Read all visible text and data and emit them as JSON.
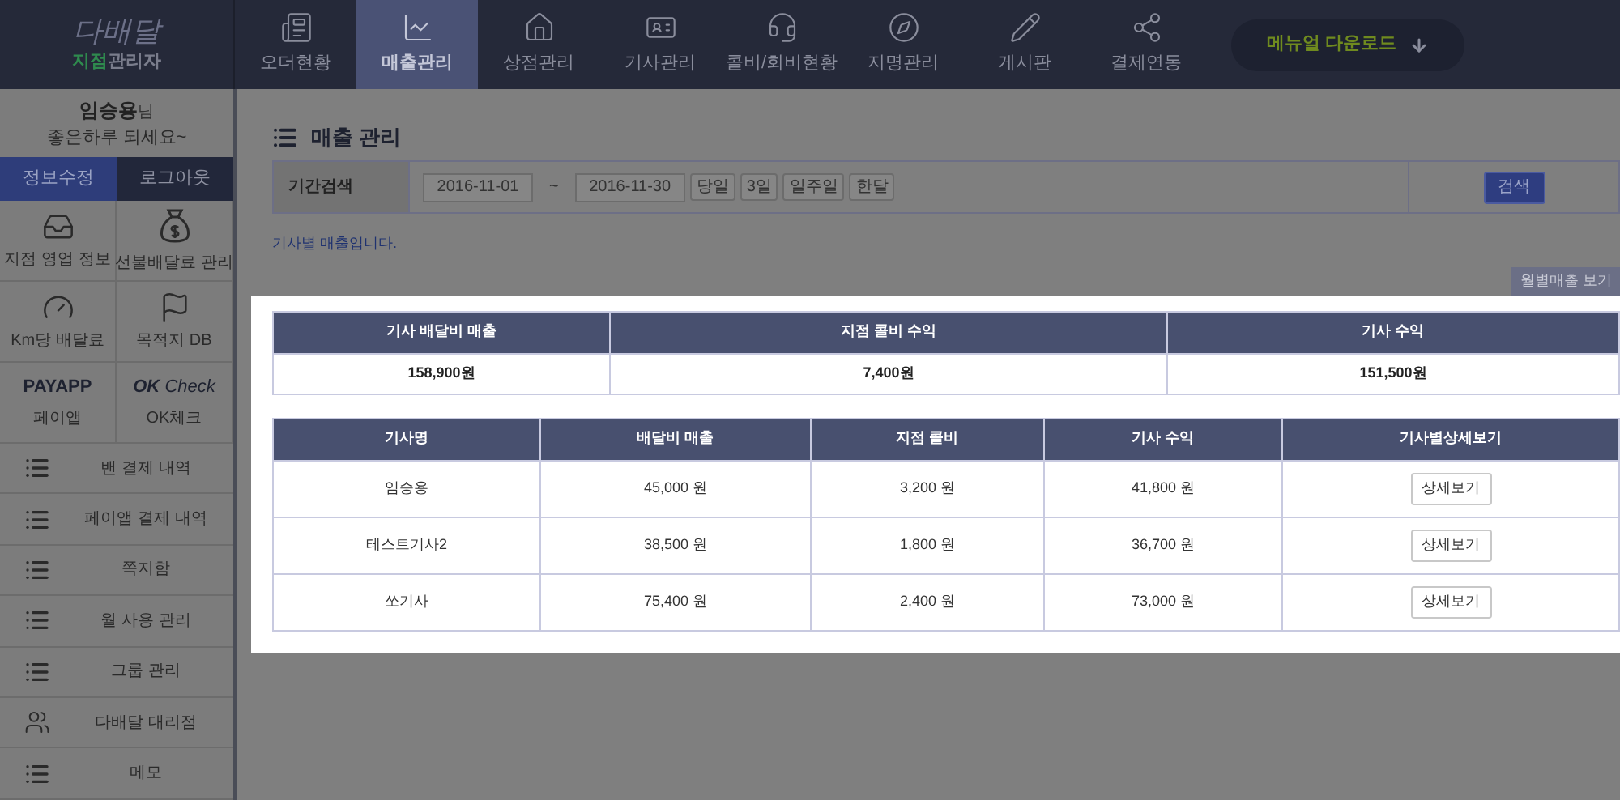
{
  "logo": {
    "wordmark": "다배달",
    "accent": "지점",
    "rest": "관리자"
  },
  "nav": [
    {
      "label": "오더현황",
      "selected": false
    },
    {
      "label": "매출관리",
      "selected": true
    },
    {
      "label": "상점관리",
      "selected": false
    },
    {
      "label": "기사관리",
      "selected": false
    },
    {
      "label": "콜비/회비현황",
      "selected": false
    },
    {
      "label": "지명관리",
      "selected": false
    },
    {
      "label": "게시판",
      "selected": false
    },
    {
      "label": "결제연동",
      "selected": false
    }
  ],
  "manual_button": "메뉴얼 다운로드",
  "sidebar": {
    "user": {
      "name": "임승용",
      "suffix": "님",
      "greeting": "좋은하루 되세요~"
    },
    "buttons": [
      {
        "label": "정보수정",
        "kind": "primary"
      },
      {
        "label": "로그아웃",
        "kind": "dark"
      }
    ],
    "tiles": [
      {
        "kind": "icon",
        "label": "지점 영업 정보"
      },
      {
        "kind": "icon",
        "label": "선불배달료 관리"
      },
      {
        "kind": "icon",
        "label": "Km당 배달료"
      },
      {
        "kind": "icon",
        "label": "목적지 DB"
      },
      {
        "kind": "logo",
        "logo": "PAYAPP",
        "label": "페이앱"
      },
      {
        "kind": "logo",
        "logo": "OK",
        "logo_rest": "Check",
        "label": "OK체크"
      }
    ],
    "items": [
      {
        "label": "밴 결제 내역",
        "kind": "list"
      },
      {
        "label": "페이앱 결제 내역",
        "kind": "list"
      },
      {
        "label": "쪽지함",
        "kind": "list"
      },
      {
        "label": "월 사용 관리",
        "kind": "list"
      },
      {
        "label": "그룹 관리",
        "kind": "list"
      },
      {
        "label": "다배달 대리점",
        "kind": "people"
      },
      {
        "label": "메모",
        "kind": "list"
      }
    ]
  },
  "page_title": "매출 관리",
  "search": {
    "label": "기간검색",
    "from": "2016-11-01",
    "separator": "~",
    "to": "2016-11-30",
    "quick": [
      "당일",
      "3일",
      "일주일",
      "한달"
    ],
    "button": "검색"
  },
  "note": "기사별 매출입니다.",
  "monthly_button": "월별매출 보기",
  "summary": {
    "columns": [
      "기사 배달비 매출",
      "지점 콜비 수익",
      "기사 수익"
    ],
    "row": [
      "158,900원",
      "7,400원",
      "151,500원"
    ]
  },
  "detail": {
    "columns": [
      "기사명",
      "배달비 매출",
      "지점 콜비",
      "기사 수익",
      "기사별상세보기"
    ],
    "rows": [
      {
        "cells": [
          "임승용",
          "45,000 원",
          "3,200 원",
          "41,800 원"
        ],
        "button": "상세보기"
      },
      {
        "cells": [
          "테스트기사2",
          "38,500 원",
          "1,800 원",
          "36,700 원"
        ],
        "button": "상세보기"
      },
      {
        "cells": [
          "쏘기사",
          "75,400 원",
          "2,400 원",
          "73,000 원"
        ],
        "button": "상세보기"
      }
    ]
  }
}
